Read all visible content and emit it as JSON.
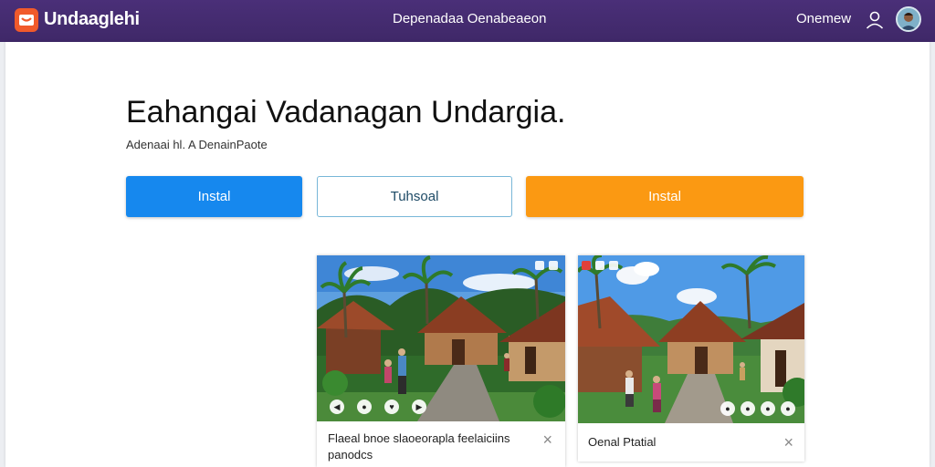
{
  "header": {
    "app_title": "Undaaglehi",
    "center_link": "Depenadaa Oenabeaeon",
    "right_link": "Onemew",
    "logo_icon": "app-logo-icon",
    "user_icon": "user-icon",
    "avatar_icon": "avatar"
  },
  "hero": {
    "title": "Eahangai Vadanagan Undargia.",
    "subtitle": "Adenaai hl. A DenainPaote"
  },
  "actions": {
    "primary_label": "Instal",
    "secondary_label": "Tuhsoal",
    "tertiary_label": "Instal"
  },
  "cards": [
    {
      "caption": "Flaeal bnoe slaoeorapla feelaiciins panodcs",
      "close_icon": "close-icon",
      "glyphs": {
        "close": "×",
        "ctrl1": "◀",
        "ctrl2": "●",
        "ctrl3": "♥",
        "ctrl4": "▶"
      }
    },
    {
      "caption": "Oenal Ptatial",
      "close_icon": "close-icon",
      "glyphs": {
        "close": "×",
        "ctrl1": "●",
        "ctrl2": "●",
        "ctrl3": "●",
        "ctrl4": "●"
      }
    }
  ],
  "colors": {
    "header_bg": "#45296f",
    "primary_button": "#1688ee",
    "secondary_border": "#78b7d8",
    "tertiary_button": "#fb9912",
    "logo_bg": "#f15a2b"
  }
}
